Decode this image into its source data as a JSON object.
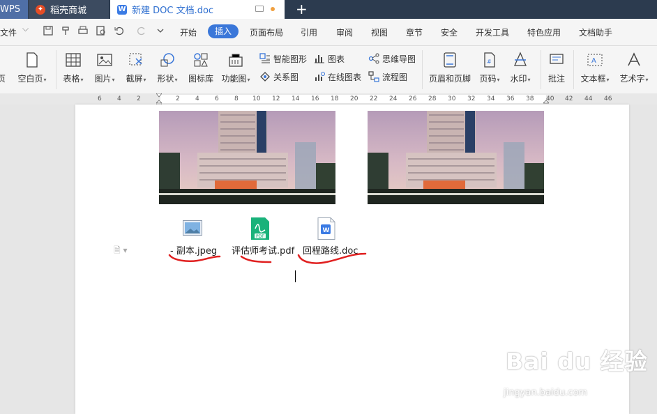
{
  "tabs": [
    {
      "label": "WPS"
    },
    {
      "label": "稻壳商城"
    },
    {
      "label": "新建 DOC 文档.doc"
    }
  ],
  "menu": {
    "file": "文件",
    "items": [
      "开始",
      "插入",
      "页面布局",
      "引用",
      "审阅",
      "视图",
      "章节",
      "安全",
      "开发工具",
      "特色应用",
      "文档助手"
    ],
    "active": "插入"
  },
  "ribbon": {
    "cover": "页",
    "blank_page": "空白页",
    "table": "表格",
    "picture": "图片",
    "screenshot": "截屏",
    "shapes": "形状",
    "icon_lib": "图标库",
    "func_chart": "功能图",
    "smart_shape": "智能图形",
    "chart": "图表",
    "mind_map": "思维导图",
    "relation": "关系图",
    "online_chart": "在线图表",
    "flowchart": "流程图",
    "header_footer": "页眉和页脚",
    "page_num": "页码",
    "watermark": "水印",
    "comment": "批注",
    "textbox": "文本框",
    "wordart": "艺术字"
  },
  "ruler": [
    "6",
    "4",
    "2",
    "2",
    "2",
    "4",
    "6",
    "8",
    "10",
    "12",
    "14",
    "16",
    "18",
    "20",
    "22",
    "24",
    "26",
    "28",
    "30",
    "32",
    "34",
    "36",
    "38",
    "40",
    "42",
    "44",
    "46"
  ],
  "attachments": [
    {
      "name": "- 副本.jpeg",
      "type": "image"
    },
    {
      "name": "评估师考试.pdf",
      "type": "pdf",
      "badge": "PDF"
    },
    {
      "name": "回程路线.doc",
      "type": "doc",
      "badge": "W"
    }
  ],
  "watermark": {
    "brand": "Bai du 经验",
    "url": "jingyan.baidu.com"
  },
  "colors": {
    "accent": "#3a77d9",
    "annotation": "#e02020",
    "titlebar": "#2c3b4f"
  }
}
